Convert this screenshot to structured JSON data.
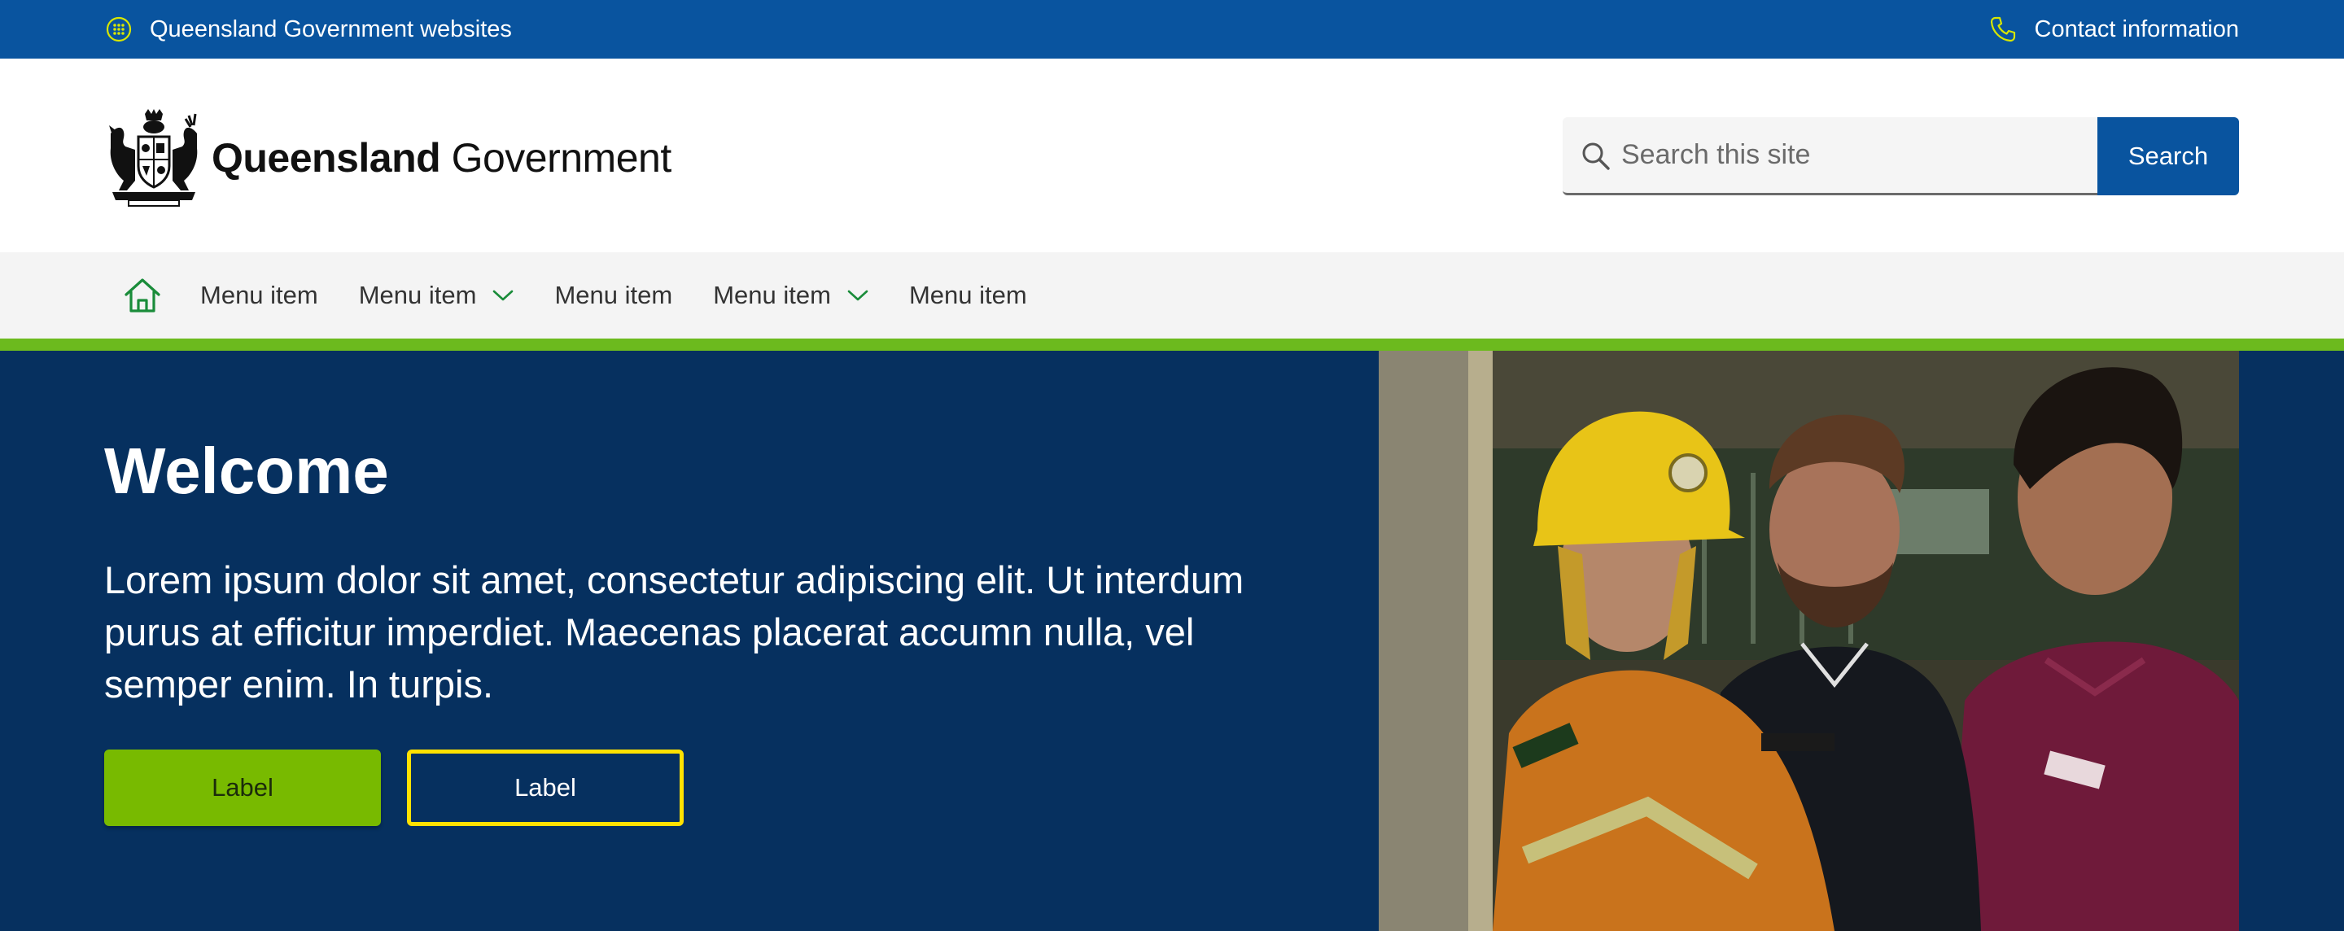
{
  "topbar": {
    "sites_label": "Queensland Government websites",
    "contact_label": "Contact information"
  },
  "header": {
    "logo_bold": "Queensland",
    "logo_regular": "Government"
  },
  "search": {
    "placeholder": "Search this site",
    "button_label": "Search"
  },
  "nav": {
    "items": [
      {
        "label": "Menu item",
        "has_dropdown": false
      },
      {
        "label": "Menu item",
        "has_dropdown": true
      },
      {
        "label": "Menu item",
        "has_dropdown": false
      },
      {
        "label": "Menu item",
        "has_dropdown": true
      },
      {
        "label": "Menu item",
        "has_dropdown": false
      }
    ]
  },
  "hero": {
    "title": "Welcome",
    "lead": "Lorem ipsum dolor sit amet, consectetur adipiscing elit. Ut interdum purus at efficitur imperdiet. Maecenas placerat accumn nulla, vel semper enim. In turpis.",
    "primary_button": "Label",
    "secondary_button": "Label"
  },
  "colors": {
    "brand_blue": "#09549f",
    "hero_navy": "#06305f",
    "accent_green": "#6cba1e",
    "button_green": "#78ba00",
    "focus_yellow": "#ffe100"
  },
  "icons": {
    "topbar_left": "grid-dots-icon",
    "topbar_right": "phone-icon",
    "search": "search-icon",
    "home": "home-icon",
    "dropdown": "chevron-down-icon"
  }
}
